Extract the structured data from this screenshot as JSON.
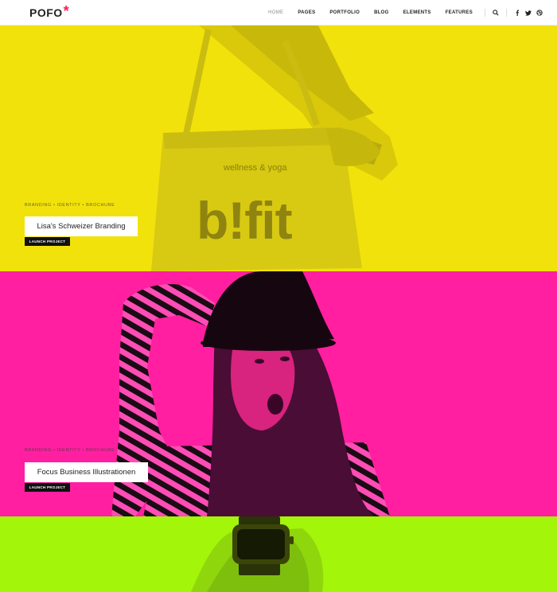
{
  "brand": {
    "logo_text": "POFO",
    "logo_mark": "*"
  },
  "nav": {
    "items": [
      {
        "label": "HOME",
        "active": true
      },
      {
        "label": "PAGES"
      },
      {
        "label": "PORTFOLIO"
      },
      {
        "label": "BLOG"
      },
      {
        "label": "ELEMENTS"
      },
      {
        "label": "FEATURES"
      }
    ],
    "icons": [
      "search-icon",
      "facebook-icon",
      "twitter-icon",
      "dribbble-icon"
    ]
  },
  "colors": {
    "yellow": "#f2e20b",
    "pink": "#ff1fa0",
    "green": "#a3f50a",
    "accent": "#ff214f"
  },
  "projects": [
    {
      "meta": "BRANDING • IDENTITY • BROCHURE",
      "title": "Lisa's Schweizer Branding",
      "button": "LAUNCH PROJECT",
      "bag_tagline": "wellness & yoga",
      "bag_logo": "b!fit"
    },
    {
      "meta": "BRANDING • IDENTITY • BROCHURE",
      "title": "Focus Business Illustrationen",
      "button": "LAUNCH PROJECT"
    }
  ]
}
